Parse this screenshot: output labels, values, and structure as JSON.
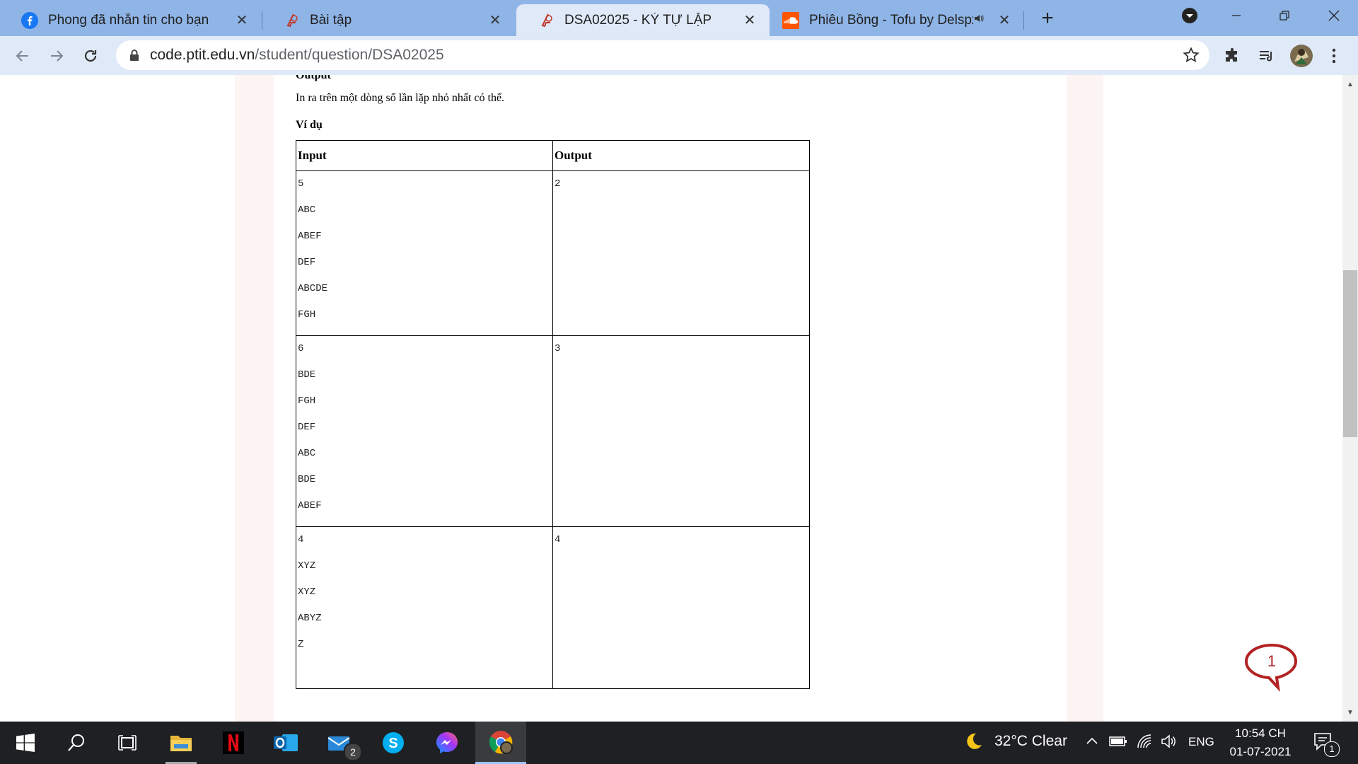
{
  "browser": {
    "tabs": [
      {
        "title": "Phong đã nhắn tin cho bạn",
        "icon": "facebook-icon"
      },
      {
        "title": "Bài tập",
        "icon": "ptit-code-icon"
      },
      {
        "title": "DSA02025 - KÝ TỰ LẶP",
        "icon": "ptit-code-icon",
        "active": true
      },
      {
        "title": "Phiêu Bồng - Tofu by Delspx",
        "icon": "soundcloud-icon"
      }
    ],
    "url_host": "code.ptit.edu.vn",
    "url_path": "/student/question/DSA02025"
  },
  "page": {
    "cut_line": "Output",
    "output_desc": "In ra trên một dòng số lần lặp nhỏ nhất có thể.",
    "example_heading": "Ví dụ",
    "table_headers": [
      "Input",
      "Output"
    ],
    "examples": [
      {
        "input": [
          "5",
          "ABC",
          "ABEF",
          "DEF",
          "ABCDE",
          "FGH"
        ],
        "output": "2"
      },
      {
        "input": [
          "6",
          "BDE",
          "FGH",
          "DEF",
          "ABC",
          "BDE",
          "ABEF"
        ],
        "output": "3"
      },
      {
        "input": [
          "4",
          "XYZ",
          "XYZ",
          "ABYZ",
          "Z"
        ],
        "output": "4"
      }
    ],
    "chat_badge": "1"
  },
  "taskbar": {
    "weather": "32°C  Clear",
    "language": "ENG",
    "time": "10:54 CH",
    "date": "01-07-2021",
    "mail_badge": "2",
    "notification_badge": "1"
  },
  "colors": {
    "tabstrip": "#8fb4e6",
    "toolbar": "#dfe9f8",
    "gutter": "#fcf5f3",
    "taskbar": "#1f2024",
    "chat_bubble": "#b22222"
  }
}
